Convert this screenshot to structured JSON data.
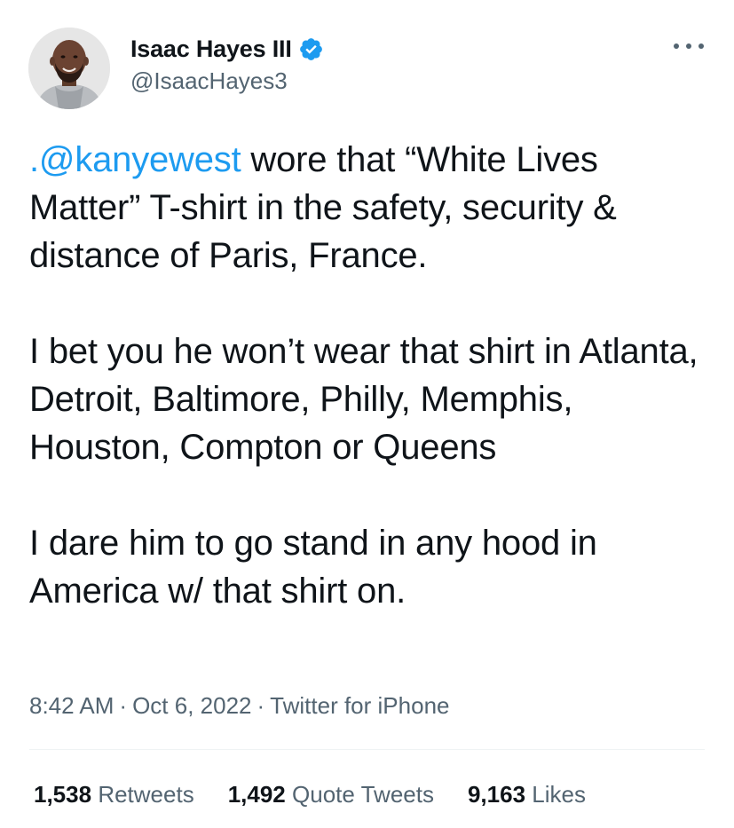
{
  "author": {
    "display_name": "Isaac Hayes III",
    "handle": "@IsaacHayes3",
    "verified": true,
    "verified_color": "#1d9bf0"
  },
  "tweet": {
    "mention": ".@kanyewest",
    "line1_rest": " wore that “White Lives Matter” T-shirt in the safety, security & distance of Paris, France.",
    "para2": "I bet you he won’t wear that shirt in Atlanta, Detroit, Baltimore, Philly, Memphis, Houston, Compton or Queens",
    "para3": "I dare him to go stand in any hood in America w/ that shirt on."
  },
  "meta": {
    "time": "8:42 AM",
    "separator": "·",
    "date": "Oct 6, 2022",
    "source": "Twitter for iPhone"
  },
  "stats": {
    "retweets_count": "1,538",
    "retweets_label": "Retweets",
    "quotes_count": "1,492",
    "quotes_label": "Quote Tweets",
    "likes_count": "9,163",
    "likes_label": "Likes"
  },
  "colors": {
    "link": "#1d9bf0",
    "secondary_text": "#536471",
    "primary_text": "#0f1419"
  },
  "icons": {
    "verified": "verified-badge-icon",
    "more": "more-options-icon"
  }
}
